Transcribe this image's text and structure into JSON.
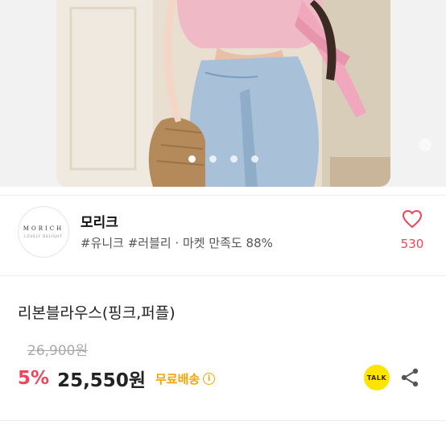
{
  "gallery": {
    "image_count": 4,
    "active_index": 0
  },
  "shop": {
    "logo_text": "MORICH",
    "logo_subtext": "LOVELY DELIGHT",
    "name": "모리크",
    "tags": "#유니크 #러블리 · 마켓 만족도 88%",
    "like_count": "530",
    "like_icon": "heart-outline-icon"
  },
  "product": {
    "title": "리본블라우스(핑크,퍼플)",
    "original_price": "26,900원",
    "discount": "5%",
    "sale_price": "25,550원",
    "shipping": "무료배송",
    "info_icon_glyph": "i"
  },
  "actions": {
    "talk_label": "TALK",
    "share_icon": "share-icon"
  },
  "colors": {
    "accent": "#f0445a",
    "shipping": "#f5a400",
    "talk_bg": "#fee500"
  }
}
